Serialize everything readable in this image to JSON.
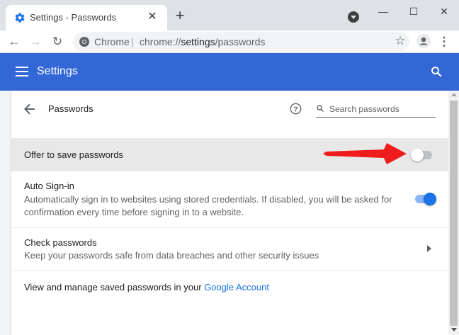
{
  "window": {
    "tab_title": "Settings - Passwords",
    "new_tab_symbol": "+",
    "minimize_symbol": "—",
    "maximize_symbol": "☐",
    "close_symbol": "✕",
    "tab_close_symbol": "✕"
  },
  "toolbar": {
    "omnibox_brand": "Chrome",
    "omnibox_separator": "|",
    "url_scheme": "chrome://",
    "url_host": "settings",
    "url_path": "/passwords",
    "back_symbol": "←",
    "forward_symbol": "→",
    "reload_symbol": "↻",
    "star_symbol": "☆",
    "menu_symbol": "⋮"
  },
  "header": {
    "title": "Settings",
    "accent_color": "#3367d6"
  },
  "passwords_page": {
    "title": "Passwords",
    "search_placeholder": "Search passwords",
    "offer_to_save": {
      "label": "Offer to save passwords",
      "enabled": false
    },
    "auto_signin": {
      "label": "Auto Sign-in",
      "description": "Automatically sign in to websites using stored credentials. If disabled, you will be asked for confirmation every time before signing in to a website.",
      "enabled": true
    },
    "check_passwords": {
      "label": "Check passwords",
      "description": "Keep your passwords safe from data breaches and other security issues"
    },
    "manage": {
      "text": "View and manage saved passwords in your ",
      "link": "Google Account"
    }
  },
  "annotation": {
    "arrow_color": "#ee1c1c"
  }
}
